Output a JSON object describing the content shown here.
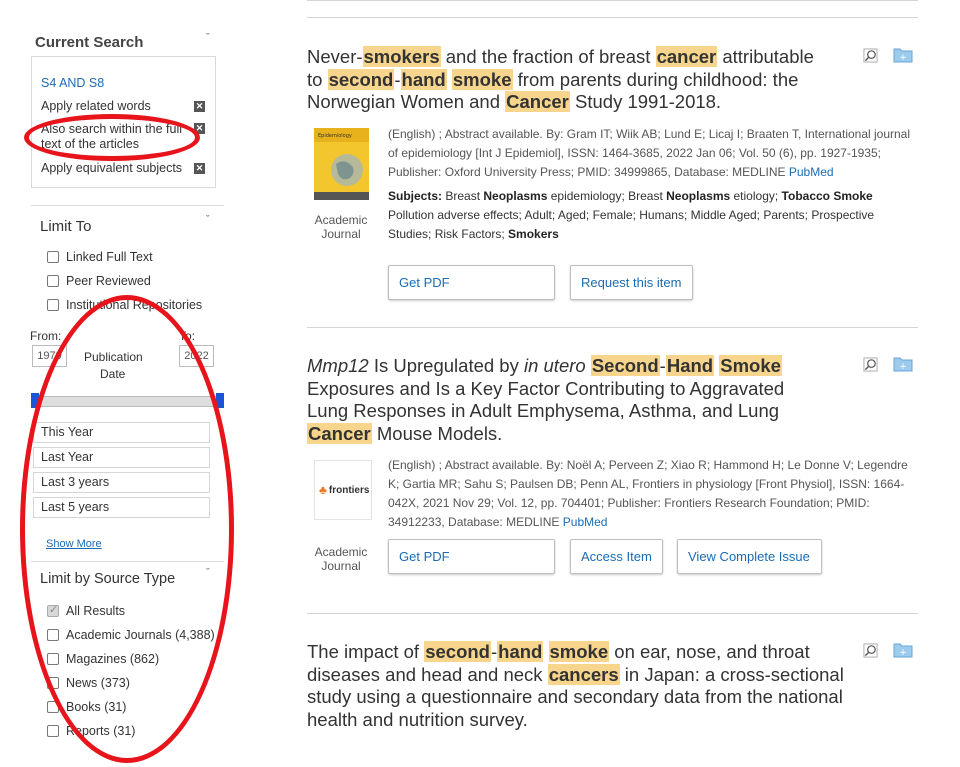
{
  "sidebar": {
    "current_search": {
      "heading": "Current Search",
      "query": "S4 AND S8",
      "options": [
        {
          "label": "Apply related words"
        },
        {
          "label_line1": "Also search within the full",
          "label_line2": "text of the articles"
        },
        {
          "label": "Apply equivalent subjects"
        }
      ]
    },
    "limit_to": {
      "heading": "Limit To",
      "checkboxes": [
        "Linked Full Text",
        "Peer Reviewed",
        "Institutional Repositories"
      ],
      "from_label": "From:",
      "to_label": "To:",
      "from_value": "1979",
      "to_value": "2022",
      "pub_date_line1": "Publication",
      "pub_date_line2": "Date",
      "date_options": [
        "This Year",
        "Last Year",
        "Last 3 years",
        "Last 5 years"
      ],
      "show_more": "Show More"
    },
    "source_type": {
      "heading": "Limit by Source Type",
      "items": [
        "All Results",
        "Academic Journals (4,388)",
        "Magazines (862)",
        "News (373)",
        "Books (31)",
        "Reports (31)"
      ]
    }
  },
  "results": [
    {
      "title_parts": [
        "Never-",
        "smokers",
        " and the fraction of breast ",
        "cancer",
        " attributable to ",
        "second",
        "-",
        "hand",
        " ",
        "smoke",
        " from parents during childhood: the Norwegian Women and ",
        "Cancer",
        " Study 1991-2018."
      ],
      "thumb_journal": "International Journal of Epidemiology",
      "type_line1": "Academic",
      "type_line2": "Journal",
      "meta_line1": "(English) ; Abstract available. By: Gram IT; Wiik AB; Lund E; Licaj I; Braaten T, International journal",
      "meta_line2": "of epidemiology [Int J Epidemiol], ISSN: 1464-3685, 2022 Jan 06; Vol. 50 (6), pp. 1927-1935;",
      "meta_line3": "Publisher: Oxford University Press; PMID: 34999865, Database: MEDLINE ",
      "meta_link": "PubMed",
      "subjects_label": "Subjects:",
      "subjects_parts": [
        " Breast ",
        "Neoplasms",
        " epidemiology; Breast ",
        "Neoplasms",
        " etiology; ",
        "Tobacco Smoke",
        " Pollution adverse effects; Adult; Aged; Female; Humans; Middle Aged; Parents; Prospective Studies; Risk Factors; ",
        "Smokers"
      ],
      "buttons": [
        "Get PDF",
        "Request this item"
      ]
    },
    {
      "title_parts": [
        "Mmp12",
        " Is Upregulated by ",
        "in utero",
        " ",
        "Second",
        "-",
        "Hand",
        " ",
        "Smoke",
        " Exposures and Is a Key Factor Contributing to Aggravated Lung Responses in Adult Emphysema, Asthma, and Lung ",
        "Cancer",
        " Mouse Models."
      ],
      "thumb_logo": "frontiers",
      "type_line1": "Academic",
      "type_line2": "Journal",
      "meta_line1": "(English) ; Abstract available. By: Noël A; Perveen Z; Xiao R; Hammond H; Le Donne V; Legendre",
      "meta_line2": "K; Gartia MR; Sahu S; Paulsen DB; Penn AL, Frontiers in physiology [Front Physiol], ISSN: 1664-",
      "meta_line3": "042X, 2021 Nov 29; Vol. 12, pp. 704401; Publisher: Frontiers Research Foundation; PMID:",
      "meta_line4": "34912233, Database: MEDLINE ",
      "meta_link": "PubMed",
      "buttons": [
        "Get PDF",
        "Access Item",
        "View Complete Issue"
      ]
    },
    {
      "title_parts": [
        "The impact of ",
        "second",
        "-",
        "hand",
        " ",
        "smoke",
        " on ear, nose, and throat diseases and head and neck ",
        "cancers",
        " in Japan: a cross-sectional study using a questionnaire and secondary data from the national health and nutrition survey."
      ]
    }
  ],
  "colors": {
    "highlight": "#f7d58c",
    "link": "#1a6bb5",
    "annotation_red": "#e8141b",
    "slider": "#1a55d6"
  }
}
